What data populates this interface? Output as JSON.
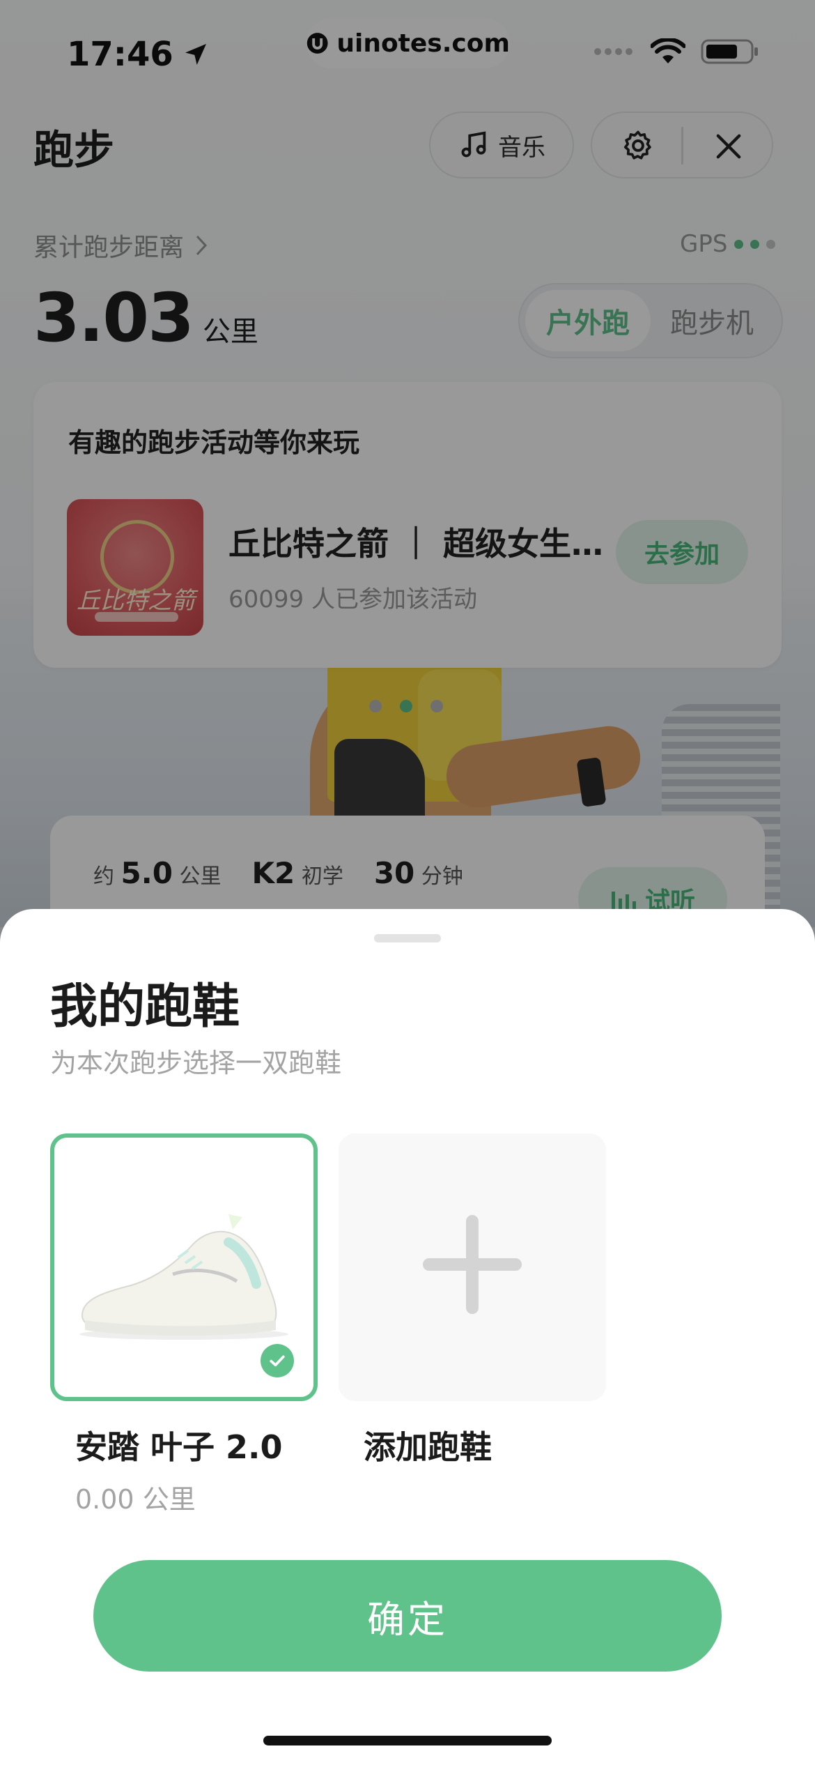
{
  "status_bar": {
    "time": "17:46",
    "site_badge": "uinotes.com"
  },
  "header": {
    "title": "跑步",
    "music_label": "音乐",
    "icons": [
      "music-note-icon",
      "gear-icon",
      "close-icon"
    ]
  },
  "summary": {
    "cumulative_label": "累计跑步距离",
    "gps_label": "GPS",
    "distance_value": "3.03",
    "distance_unit": "公里",
    "modes": [
      "户外跑",
      "跑步机"
    ],
    "active_mode": "户外跑"
  },
  "activity_card": {
    "heading": "有趣的跑步活动等你来玩",
    "thumb_text": "丘比特之箭",
    "name": "丘比特之箭 ｜ 超级女生系列",
    "participants": "60099 人已参加该活动",
    "join_label": "去参加"
  },
  "carousel": {
    "count": 3,
    "active_index": 1
  },
  "plan_card": {
    "prefix": "约",
    "distance": "5.0",
    "distance_unit": "公里",
    "level": "K2",
    "level_label": "初学",
    "duration": "30",
    "duration_unit": "分钟",
    "listen_label": "试听"
  },
  "sheet": {
    "title": "我的跑鞋",
    "subtitle": "为本次跑步选择一双跑鞋",
    "shoes": [
      {
        "name": "安踏 叶子 2.0",
        "distance": "0.00 公里",
        "selected": true
      }
    ],
    "add_label": "添加跑鞋",
    "confirm_label": "确定"
  },
  "colors": {
    "accent": "#5ec28a",
    "accent_light": "#e5f5ec",
    "dim_overlay": "rgba(0,0,0,0.40)"
  }
}
